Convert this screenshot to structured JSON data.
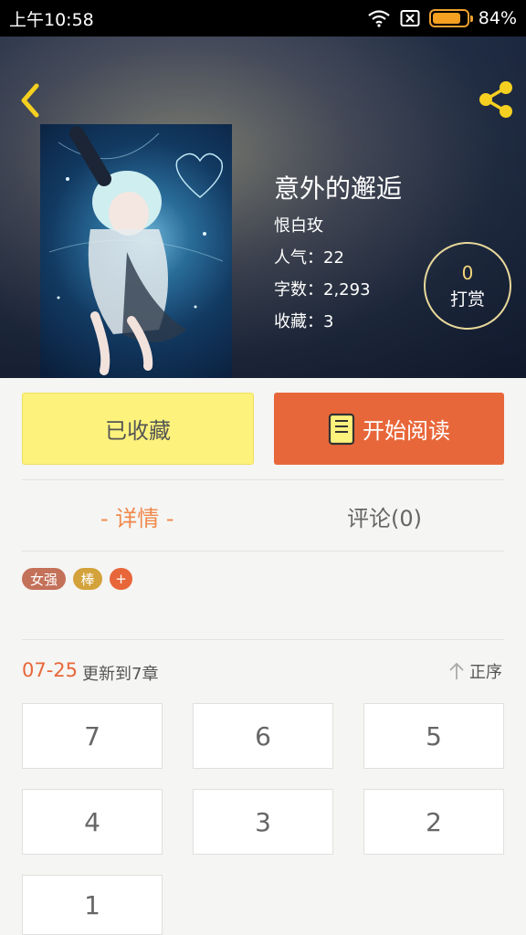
{
  "status_bar": {
    "time": "上午10:58",
    "battery": "84%",
    "battery_level": 0.84
  },
  "book": {
    "title": "意外的邂逅",
    "author": "恨白玫",
    "popularity": "人气：22",
    "word_count": "字数：2,293",
    "favorites": "收藏：3"
  },
  "reward": {
    "count": "0",
    "label": "打赏"
  },
  "actions": {
    "favorited_label": "已收藏",
    "start_reading_label": "开始阅读"
  },
  "tabs": {
    "detail": "- 详情 -",
    "comments": "评论(0)"
  },
  "tags": [
    {
      "label": "女强",
      "color": "#c4715a"
    },
    {
      "label": "棒",
      "color": "#d4a23a"
    },
    {
      "label": "+",
      "color": "#e8673a"
    }
  ],
  "update": {
    "date": "07-25",
    "text": "更新到7章",
    "order_label": "正序"
  },
  "chapters": [
    "7",
    "6",
    "5",
    "4",
    "3",
    "2",
    "1"
  ],
  "colors": {
    "accent": "#e8673a",
    "favorite_button": "#fdf27c",
    "tab_active": "#f0884a"
  },
  "icons": {
    "back": "chevron-left-icon",
    "share": "share-icon",
    "read": "book-icon",
    "order": "arrow-up-icon"
  }
}
